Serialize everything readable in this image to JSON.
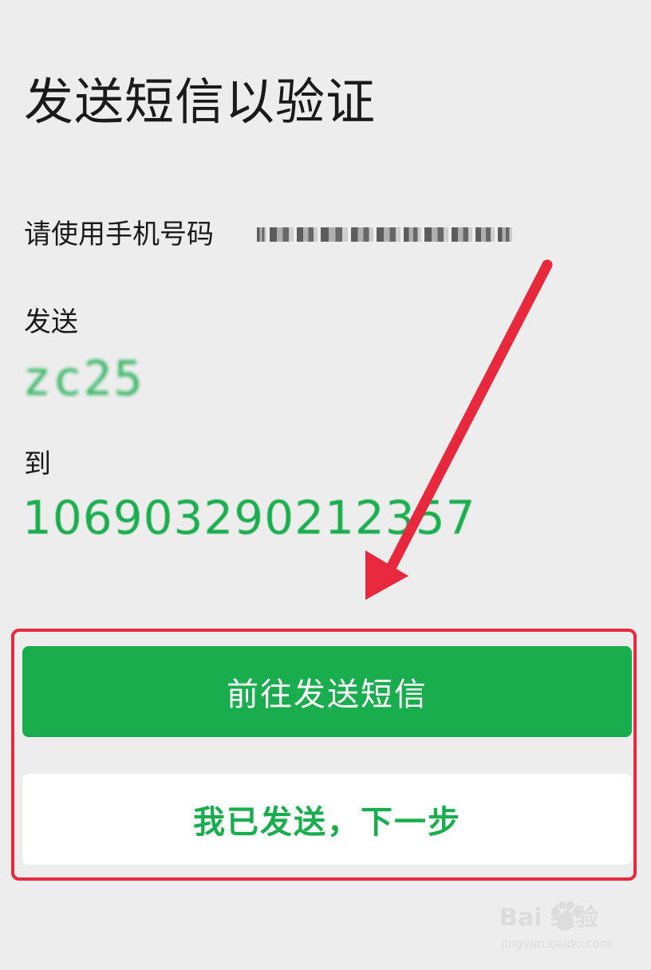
{
  "page": {
    "title": "发送短信以验证"
  },
  "instructions": {
    "phone_label": "请使用手机号码",
    "send_label": "发送",
    "code": "zc25",
    "to_label": "到",
    "number": "106903290212357"
  },
  "buttons": {
    "primary_label": "前往发送短信",
    "secondary_label": "我已发送，下一步"
  },
  "annotations": {
    "arrow_icon": "red-arrow-icon",
    "highlight_color": "#e8283c"
  },
  "watermark": {
    "brand": "Bai 经验",
    "url": "jingyan.baidu.com"
  },
  "colors": {
    "accent": "#1aad4e",
    "background": "#ededed"
  }
}
